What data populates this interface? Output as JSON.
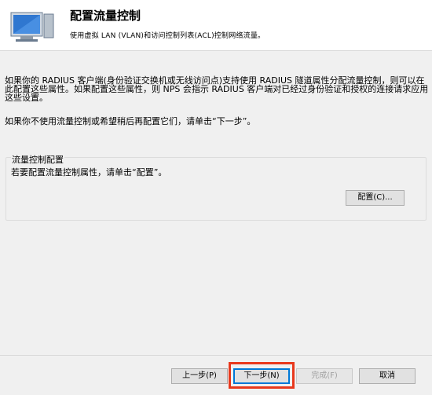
{
  "header": {
    "title": "配置流量控制",
    "subtitle": "使用虚拟 LAN (VLAN)和访问控制列表(ACL)控制网络流量。"
  },
  "intro": {
    "paragraph1": "如果你的 RADIUS 客户端(身份验证交换机或无线访问点)支持使用 RADIUS 隧道属性分配流量控制，则可以在此配置这些属性。如果配置这些属性，则 NPS 会指示 RADIUS 客户端对已经过身份验证和授权的连接请求应用这些设置。",
    "paragraph2": "如果你不使用流量控制或希望稍后再配置它们，请单击“下一步”。"
  },
  "traffic_group": {
    "title": "流量控制配置",
    "description": "若要配置流量控制属性，请单击“配置”。",
    "configure_label": "配置(C)..."
  },
  "footer": {
    "back_label": "上一步(P)",
    "next_label": "下一步(N)",
    "finish_label": "完成(F)",
    "cancel_label": "取消"
  },
  "colors": {
    "highlight": "#e8381c",
    "accent": "#0078d7"
  }
}
